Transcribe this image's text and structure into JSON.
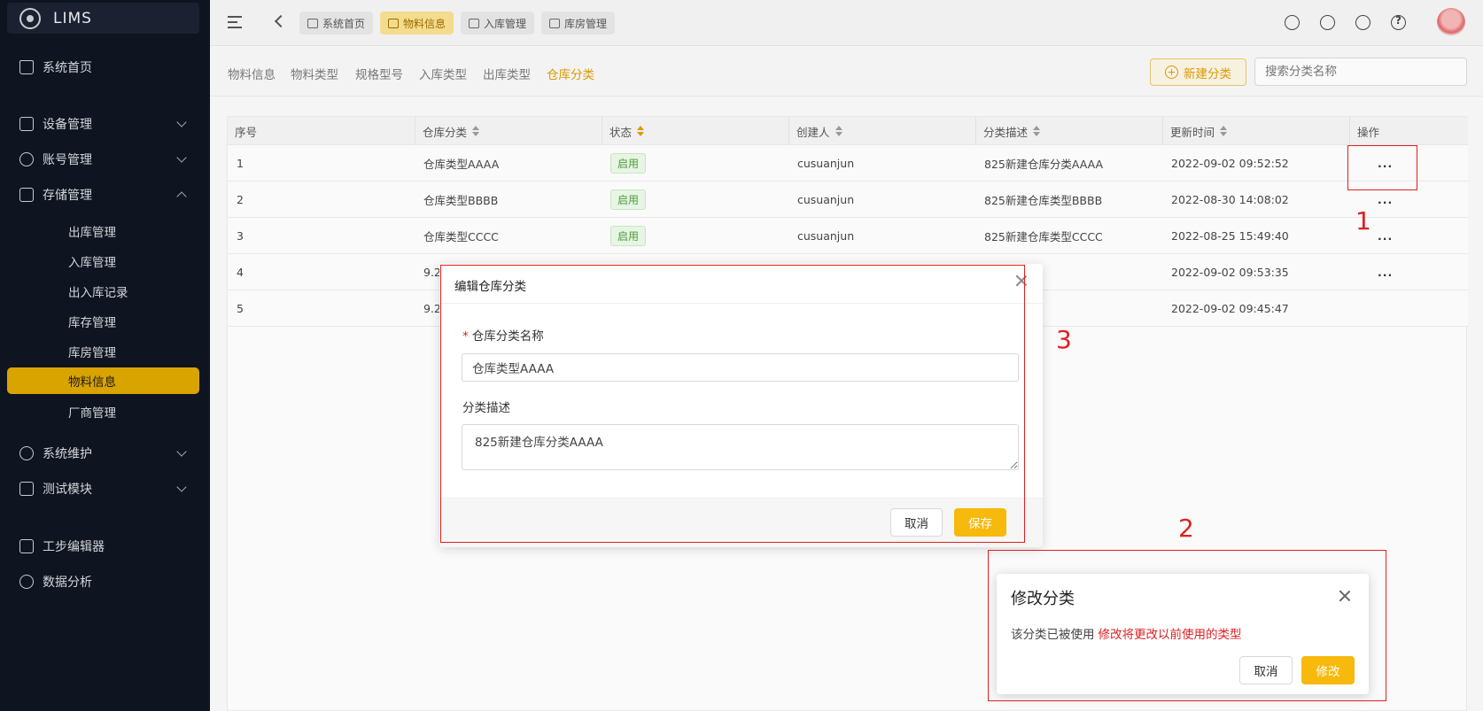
{
  "app": {
    "name": "LIMS"
  },
  "sidebar": {
    "items": [
      {
        "label": "系统首页"
      },
      {
        "label": "设备管理"
      },
      {
        "label": "账号管理"
      },
      {
        "label": "存储管理"
      },
      {
        "label": "系统维护"
      },
      {
        "label": "测试模块"
      },
      {
        "label": "工步编辑器"
      },
      {
        "label": "数据分析"
      }
    ],
    "storage_sub": [
      {
        "label": "出库管理"
      },
      {
        "label": "入库管理"
      },
      {
        "label": "出入库记录"
      },
      {
        "label": "库存管理"
      },
      {
        "label": "库房管理"
      },
      {
        "label": "物料信息"
      },
      {
        "label": "厂商管理"
      }
    ]
  },
  "topbar": {
    "tabs": [
      {
        "label": "系统首页"
      },
      {
        "label": "物料信息"
      },
      {
        "label": "入库管理"
      },
      {
        "label": "库房管理"
      }
    ]
  },
  "subnav": {
    "items": [
      "物料信息",
      "物料类型",
      "规格型号",
      "入库类型",
      "出库类型",
      "仓库分类"
    ],
    "new_label": "新建分类",
    "search_placeholder": "搜索分类名称"
  },
  "table": {
    "columns": [
      "序号",
      "仓库分类",
      "状态",
      "创建人",
      "分类描述",
      "更新时间",
      "操作"
    ],
    "rows": [
      {
        "no": "1",
        "category": "仓库类型AAAA",
        "status": "启用",
        "creator": "cusuanjun",
        "desc": "825新建仓库分类AAAA",
        "updated": "2022-09-02 09:52:52",
        "action": "..."
      },
      {
        "no": "2",
        "category": "仓库类型BBBB",
        "status": "启用",
        "creator": "cusuanjun",
        "desc": "825新建仓库类型BBBB",
        "updated": "2022-08-30 14:08:02",
        "action": "..."
      },
      {
        "no": "3",
        "category": "仓库类型CCCC",
        "status": "启用",
        "creator": "cusuanjun",
        "desc": "825新建仓库类型CCCC",
        "updated": "2022-08-25 15:49:40",
        "action": "..."
      },
      {
        "no": "4",
        "category": "9.2",
        "status": "",
        "creator": "",
        "desc": "",
        "updated": "2022-09-02 09:53:35",
        "action": "..."
      },
      {
        "no": "5",
        "category": "9.2",
        "status": "",
        "creator": "",
        "desc": "",
        "updated": "2022-09-02 09:45:47",
        "action": "..."
      }
    ]
  },
  "annotations": {
    "n1": "1",
    "n2": "2",
    "n3": "3"
  },
  "edit_dialog": {
    "title": "编辑仓库分类",
    "name_label": "仓库分类名称",
    "name_value": "仓库类型AAAA",
    "desc_label": "分类描述",
    "desc_value": "825新建仓库分类AAAA",
    "cancel": "取消",
    "save": "保存"
  },
  "confirm_dialog": {
    "title": "修改分类",
    "message": "该分类已被使用",
    "warning": "修改将更改以前使用的类型",
    "cancel": "取消",
    "confirm": "修改"
  },
  "colors": {
    "accent": "#f6b90c",
    "sidebar_bg": "#0e1420",
    "active_menu": "#d9a300",
    "annotation": "#e02020"
  }
}
